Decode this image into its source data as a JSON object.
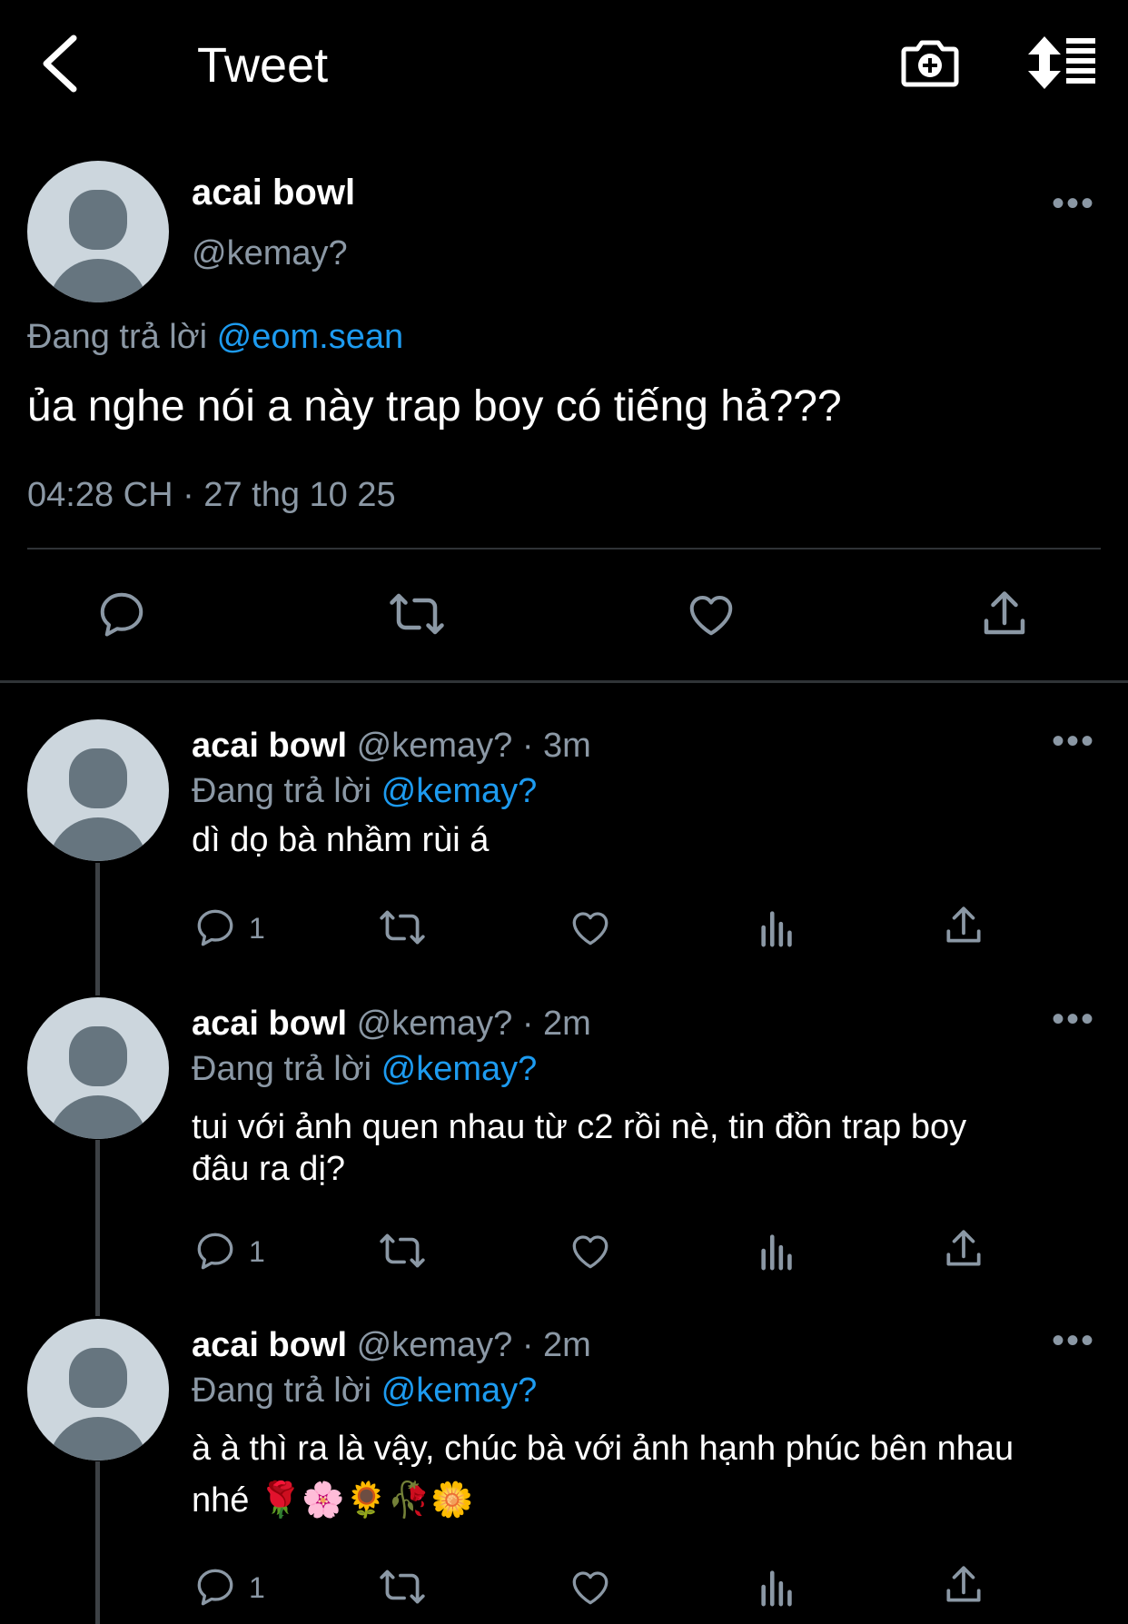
{
  "header": {
    "title": "Tweet"
  },
  "main_tweet": {
    "name": "acai bowl",
    "handle": "@kemay?",
    "replying_prefix": "Đang trả lời",
    "replying_to": "@eom.sean",
    "text": "ủa nghe nói a này trap boy có tiếng hả???",
    "timestamp": "04:28 CH · 27 thg 10 25"
  },
  "replies": [
    {
      "name": "acai bowl",
      "meta": "@kemay? · 3m",
      "replying_prefix": "Đang trả lời",
      "replying_to": "@kemay?",
      "line1": "dì dọ bà nhầm rùi á",
      "line2": "",
      "reply_count": "1"
    },
    {
      "name": "acai bowl",
      "meta": "@kemay? · 2m",
      "replying_prefix": "Đang trả lời",
      "replying_to": "@kemay?",
      "line1": "tui với ảnh quen nhau từ c2 rồi nè, tin đồn trap boy",
      "line2": "đâu ra dị?",
      "reply_count": "1"
    },
    {
      "name": "acai bowl",
      "meta": "@kemay? · 2m",
      "replying_prefix": "Đang trả lời",
      "replying_to": "@kemay?",
      "line1": "à à thì ra là vậy, chúc bà với ảnh hạnh phúc bên nhau",
      "line2": "nhé 🌹🌸🌻🥀🌼",
      "reply_count": "1"
    }
  ],
  "colors": {
    "background": "#000000",
    "accent": "#1d9bf0",
    "muted": "#8b98a5"
  }
}
